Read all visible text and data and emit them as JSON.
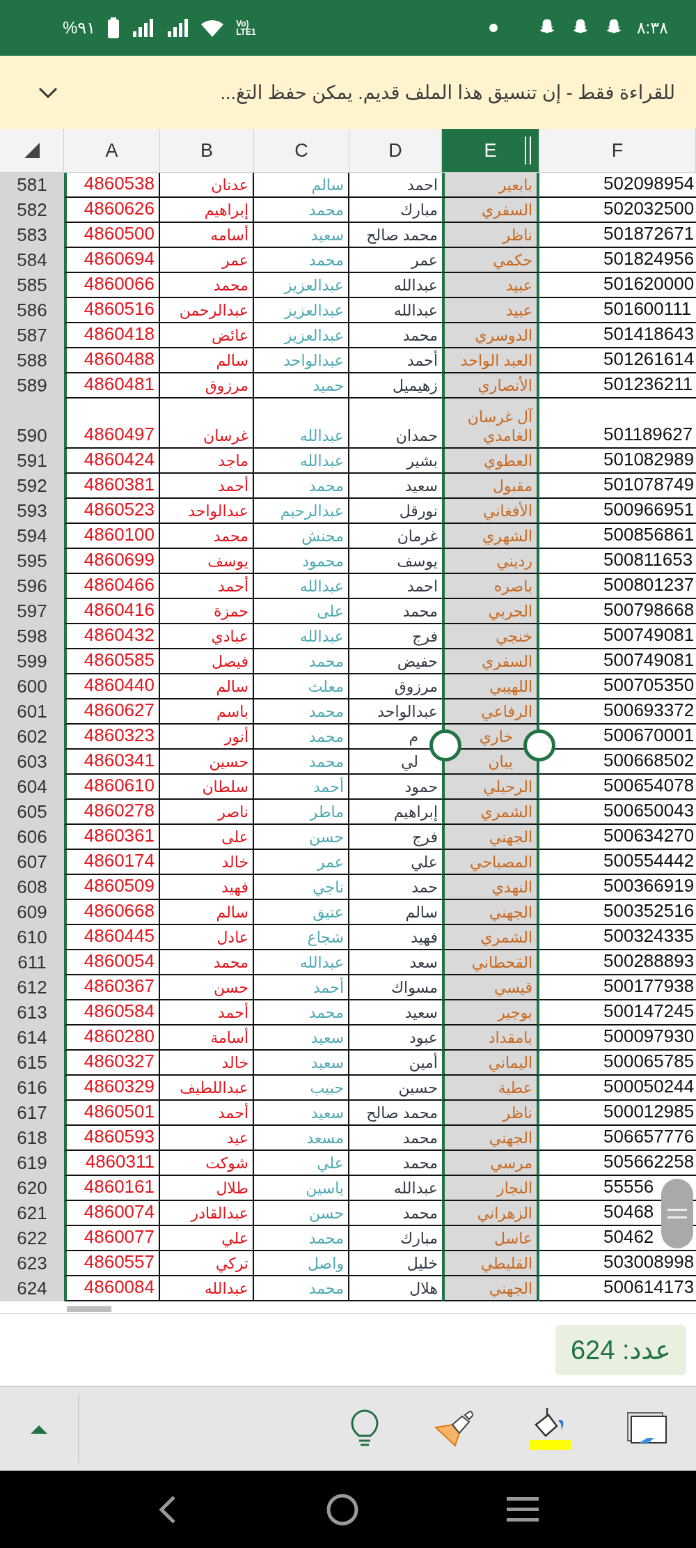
{
  "status_bar": {
    "time": "٨:٣٨",
    "battery": "%٩١",
    "network_top": "Vo)",
    "network_bottom": "LTE1"
  },
  "banner": {
    "message": "للقراءة فقط - إن تنسيق هذا الملف قديم. يمكن حفظ التغ..."
  },
  "columns": [
    {
      "label": "F",
      "selected": false
    },
    {
      "label": "E",
      "selected": true
    },
    {
      "label": "D",
      "selected": false
    },
    {
      "label": "C",
      "selected": false
    },
    {
      "label": "B",
      "selected": false
    },
    {
      "label": "A",
      "selected": false
    }
  ],
  "rows": [
    {
      "number": "581",
      "cells": [
        "502098954",
        "بابعير",
        "احمد",
        "سالم",
        "عدنان",
        "4860538"
      ]
    },
    {
      "number": "582",
      "cells": [
        "502032500",
        "السفري",
        "مبارك",
        "محمد",
        "إبراهيم",
        "4860626"
      ]
    },
    {
      "number": "583",
      "cells": [
        "501872671",
        "ناظر",
        "محمد صالح",
        "سعيد",
        "أسامه",
        "4860500"
      ]
    },
    {
      "number": "584",
      "cells": [
        "501824956",
        "حكمي",
        "عمر",
        "محمد",
        "عمر",
        "4860694"
      ]
    },
    {
      "number": "585",
      "cells": [
        "501620000",
        "عبيد",
        "عبدالله",
        "عبدالعزيز",
        "محمد",
        "4860066"
      ]
    },
    {
      "number": "586",
      "cells": [
        "501600111",
        "عبيد",
        "عبدالله",
        "عبدالعزيز",
        "عبدالرحمن",
        "4860516"
      ]
    },
    {
      "number": "587",
      "cells": [
        "501418643",
        "الدوسري",
        "محمد",
        "عبدالعزيز",
        "عائض",
        "4860418"
      ]
    },
    {
      "number": "588",
      "cells": [
        "501261614",
        "العبد الواحد",
        "أحمد",
        "عبدالواحد",
        "سالم",
        "4860488"
      ]
    },
    {
      "number": "589",
      "cells": [
        "501236211",
        "الأنصاري",
        "زهيميل",
        "حميد",
        "مرزوق",
        "4860481"
      ]
    },
    {
      "number": "590",
      "cells": [
        "501189627",
        "آل غرسان الغامدي",
        "حمدان",
        "عبدالله",
        "غرسان",
        "4860497"
      ]
    },
    {
      "number": "591",
      "cells": [
        "501082989",
        "العطوي",
        "بشير",
        "عبدالله",
        "ماجد",
        "4860424"
      ]
    },
    {
      "number": "592",
      "cells": [
        "501078749",
        "مقبول",
        "سعيد",
        "محمد",
        "أحمد",
        "4860381"
      ]
    },
    {
      "number": "593",
      "cells": [
        "500966951",
        "الأفغاني",
        "نورقل",
        "عبدالرحيم",
        "عبدالواحد",
        "4860523"
      ]
    },
    {
      "number": "594",
      "cells": [
        "500856861",
        "الشهري",
        "غرمان",
        "محنش",
        "محمد",
        "4860100"
      ]
    },
    {
      "number": "595",
      "cells": [
        "500811653",
        "رديني",
        "يوسف",
        "محمود",
        "يوسف",
        "4860699"
      ]
    },
    {
      "number": "596",
      "cells": [
        "500801237",
        "باصره",
        "احمد",
        "عبدالله",
        "أحمد",
        "4860466"
      ]
    },
    {
      "number": "597",
      "cells": [
        "500798668",
        "الحربي",
        "محمد",
        "على",
        "حمزة",
        "4860416"
      ]
    },
    {
      "number": "598",
      "cells": [
        "500749081",
        "خنجي",
        "فرج",
        "عبدالله",
        "عبادي",
        "4860432"
      ]
    },
    {
      "number": "599",
      "cells": [
        "500749081",
        "السفري",
        "حفيض",
        "محمد",
        "فيصل",
        "4860585"
      ]
    },
    {
      "number": "600",
      "cells": [
        "500705350",
        "اللهيبي",
        "مرزوق",
        "معلث",
        "سالم",
        "4860440"
      ]
    },
    {
      "number": "601",
      "cells": [
        "500693372",
        "الرفاعي",
        "عبدالواحد",
        "محمد",
        "باسم",
        "4860627"
      ]
    },
    {
      "number": "602",
      "cells": [
        "500670001",
        "خاري",
        "م",
        "محمد",
        "أنور",
        "4860323"
      ]
    },
    {
      "number": "603",
      "cells": [
        "500668502",
        "يبان",
        "لي",
        "محمد",
        "حسين",
        "4860341"
      ]
    },
    {
      "number": "604",
      "cells": [
        "500654078",
        "الرحيلي",
        "حمود",
        "أحمد",
        "سلطان",
        "4860610"
      ]
    },
    {
      "number": "605",
      "cells": [
        "500650043",
        "الشمري",
        "إبراهيم",
        "ماطر",
        "ناصر",
        "4860278"
      ]
    },
    {
      "number": "606",
      "cells": [
        "500634270",
        "الجهني",
        "فرج",
        "حسن",
        "على",
        "4860361"
      ]
    },
    {
      "number": "607",
      "cells": [
        "500554442",
        "المصباحي",
        "علي",
        "عمر",
        "خالد",
        "4860174"
      ]
    },
    {
      "number": "608",
      "cells": [
        "500366919",
        "النهدي",
        "حمد",
        "ناجي",
        "فهيد",
        "4860509"
      ]
    },
    {
      "number": "609",
      "cells": [
        "500352516",
        "الجهني",
        "سالم",
        "عتيق",
        "سالم",
        "4860668"
      ]
    },
    {
      "number": "610",
      "cells": [
        "500324335",
        "الشمري",
        "فهيد",
        "شجاع",
        "عادل",
        "4860445"
      ]
    },
    {
      "number": "611",
      "cells": [
        "500288893",
        "القحطاني",
        "سعد",
        "عبدالله",
        "محمد",
        "4860054"
      ]
    },
    {
      "number": "612",
      "cells": [
        "500177938",
        "قيسي",
        "مسواك",
        "أحمد",
        "حسن",
        "4860367"
      ]
    },
    {
      "number": "613",
      "cells": [
        "500147245",
        "بوجير",
        "سعيد",
        "محمد",
        "أحمد",
        "4860584"
      ]
    },
    {
      "number": "614",
      "cells": [
        "500097930",
        "بامقداد",
        "عبود",
        "سعيد",
        "أسامة",
        "4860280"
      ]
    },
    {
      "number": "615",
      "cells": [
        "500065785",
        "اليماني",
        "أمين",
        "سعيد",
        "خالد",
        "4860327"
      ]
    },
    {
      "number": "616",
      "cells": [
        "500050244",
        "عطية",
        "حسين",
        "حبيب",
        "عبداللطيف",
        "4860329"
      ]
    },
    {
      "number": "617",
      "cells": [
        "500012985",
        "ناظر",
        "محمد صالح",
        "سعيد",
        "أحمد",
        "4860501"
      ]
    },
    {
      "number": "618",
      "cells": [
        "506657776",
        "الجهني",
        "محمد",
        "مسعد",
        "عيد",
        "4860593"
      ]
    },
    {
      "number": "619",
      "cells": [
        "505662258",
        "مرسي",
        "محمد",
        "علي",
        "شوكت",
        "4860311"
      ]
    },
    {
      "number": "620",
      "cells": [
        "55556",
        "النجار",
        "عبدالله",
        "ياسين",
        "طلال",
        "4860161"
      ]
    },
    {
      "number": "621",
      "cells": [
        "50468",
        "الزهراني",
        "محمد",
        "حسن",
        "عبدالقادر",
        "4860074"
      ]
    },
    {
      "number": "622",
      "cells": [
        "50462",
        "عاسل",
        "مبارك",
        "محمد",
        "علي",
        "4860077"
      ]
    },
    {
      "number": "623",
      "cells": [
        "503008998",
        "القليطي",
        "خليل",
        "واصل",
        "تركي",
        "4860557"
      ]
    },
    {
      "number": "624",
      "cells": [
        "500614173",
        "الجهني",
        "هلال",
        "محمد",
        "عبدالله",
        "4860084"
      ]
    }
  ],
  "count": {
    "label": "عدد: 624"
  }
}
